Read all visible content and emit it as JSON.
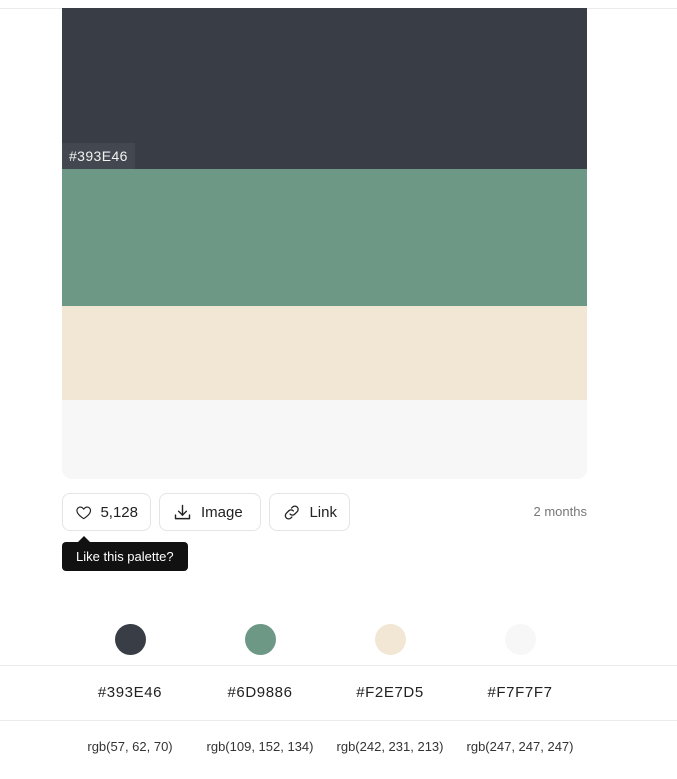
{
  "palette": {
    "colors": [
      {
        "hex": "#393E46",
        "rgb": "rgb(57, 62, 70)",
        "color": "#393E46"
      },
      {
        "hex": "#6D9886",
        "rgb": "rgb(109, 152, 134)",
        "color": "#6D9886"
      },
      {
        "hex": "#F2E7D5",
        "rgb": "rgb(242, 231, 213)",
        "color": "#F2E7D5"
      },
      {
        "hex": "#F7F7F7",
        "rgb": "rgb(247, 247, 247)",
        "color": "#F7F7F7"
      }
    ],
    "hovered_index": 0
  },
  "actions": {
    "like_count": "5,128",
    "image_label": "Image",
    "link_label": "Link",
    "like_icon": "heart-icon",
    "image_icon": "download-icon",
    "link_icon": "link-icon"
  },
  "meta": {
    "time_ago": "2 months"
  },
  "tooltip": {
    "text": "Like this palette?"
  }
}
